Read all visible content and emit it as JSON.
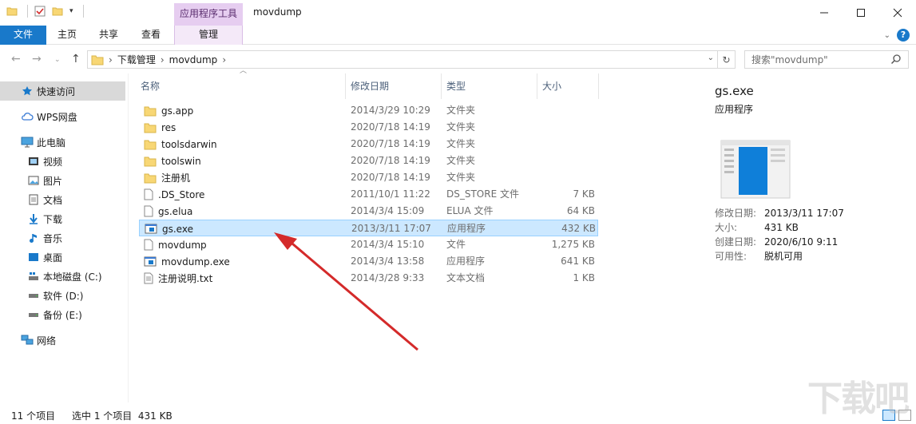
{
  "window": {
    "context_tab_title": "应用程序工具",
    "title": "movdump"
  },
  "ribbon": {
    "tabs": [
      "文件",
      "主页",
      "共享",
      "查看",
      "管理"
    ]
  },
  "address": {
    "crumbs": [
      "下载管理",
      "movdump"
    ],
    "search_placeholder": "搜索\"movdump\""
  },
  "nav": {
    "items": [
      {
        "label": "快速访问",
        "icon": "star-icon"
      },
      {
        "label": "WPS网盘",
        "icon": "cloud-icon"
      },
      {
        "label": "此电脑",
        "icon": "computer-icon"
      },
      {
        "label": "视频",
        "icon": "video-folder-icon"
      },
      {
        "label": "图片",
        "icon": "pictures-folder-icon"
      },
      {
        "label": "文档",
        "icon": "documents-folder-icon"
      },
      {
        "label": "下载",
        "icon": "download-icon"
      },
      {
        "label": "音乐",
        "icon": "music-icon"
      },
      {
        "label": "桌面",
        "icon": "desktop-icon"
      },
      {
        "label": "本地磁盘 (C:)",
        "icon": "drive-c-icon"
      },
      {
        "label": "软件 (D:)",
        "icon": "drive-icon"
      },
      {
        "label": "备份 (E:)",
        "icon": "drive-icon"
      },
      {
        "label": "网络",
        "icon": "network-icon"
      }
    ]
  },
  "list": {
    "columns": [
      "名称",
      "修改日期",
      "类型",
      "大小"
    ],
    "rows": [
      {
        "name": "gs.app",
        "date": "2014/3/29 10:29",
        "type": "文件夹",
        "size": "",
        "icon": "folder-icon"
      },
      {
        "name": "res",
        "date": "2020/7/18 14:19",
        "type": "文件夹",
        "size": "",
        "icon": "folder-icon"
      },
      {
        "name": "toolsdarwin",
        "date": "2020/7/18 14:19",
        "type": "文件夹",
        "size": "",
        "icon": "folder-icon"
      },
      {
        "name": "toolswin",
        "date": "2020/7/18 14:19",
        "type": "文件夹",
        "size": "",
        "icon": "folder-icon"
      },
      {
        "name": "注册机",
        "date": "2020/7/18 14:19",
        "type": "文件夹",
        "size": "",
        "icon": "folder-icon"
      },
      {
        "name": ".DS_Store",
        "date": "2011/10/1 11:22",
        "type": "DS_STORE 文件",
        "size": "7 KB",
        "icon": "file-icon"
      },
      {
        "name": "gs.elua",
        "date": "2014/3/4 15:09",
        "type": "ELUA 文件",
        "size": "64 KB",
        "icon": "file-icon"
      },
      {
        "name": "gs.exe",
        "date": "2013/3/11 17:07",
        "type": "应用程序",
        "size": "432 KB",
        "icon": "exe-icon"
      },
      {
        "name": "movdump",
        "date": "2014/3/4 15:10",
        "type": "文件",
        "size": "1,275 KB",
        "icon": "file-icon"
      },
      {
        "name": "movdump.exe",
        "date": "2014/3/4 13:58",
        "type": "应用程序",
        "size": "641 KB",
        "icon": "exe-icon"
      },
      {
        "name": "注册说明.txt",
        "date": "2014/3/28 9:33",
        "type": "文本文档",
        "size": "1 KB",
        "icon": "text-file-icon"
      }
    ],
    "selected_index": 7
  },
  "details": {
    "name": "gs.exe",
    "kind": "应用程序",
    "props": [
      {
        "k": "修改日期:",
        "v": "2013/3/11 17:07"
      },
      {
        "k": "大小:",
        "v": "431 KB"
      },
      {
        "k": "创建日期:",
        "v": "2020/6/10 9:11"
      },
      {
        "k": "可用性:",
        "v": "脱机可用"
      }
    ]
  },
  "status": {
    "count": "11 个项目",
    "selection": "选中 1 个项目  431 KB"
  },
  "watermark": "下载吧",
  "colors": {
    "accent": "#1979ca",
    "selection": "#cce8ff",
    "arrow": "#d42a2a",
    "folder": "#f8d775"
  }
}
